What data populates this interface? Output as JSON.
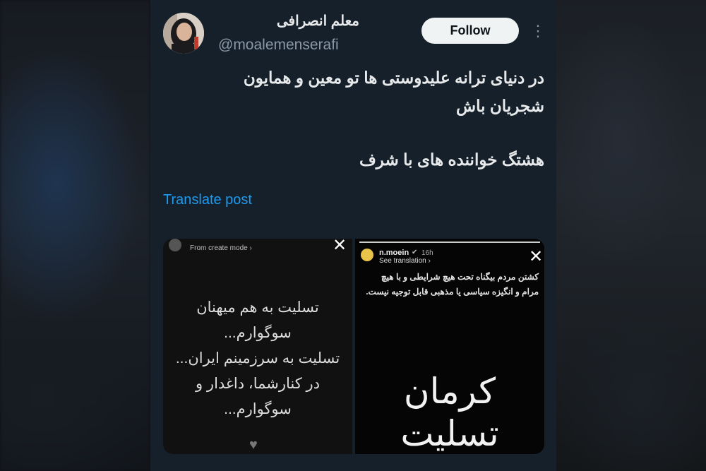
{
  "post": {
    "author_name": "معلم انصرافی",
    "handle": "@moalemenserafi",
    "follow_label": "Follow",
    "text_line1": "در دنیای ترانه علیدوستی ها تو معین و همایون",
    "text_line2": "شجریان باش",
    "text_line3": "هشتگ خواننده های با شرف",
    "translate_label": "Translate post"
  },
  "media": {
    "left_story": {
      "header_sub": "From create mode ›",
      "body_lines": [
        "تسلیت به هم میهنان",
        "سوگوارم...",
        "تسلیت به سرزمینم ایران...",
        "در کنارشما، داغدار و",
        "سوگوارم..."
      ]
    },
    "right_story": {
      "username": "n.moein",
      "time": "16h",
      "translation_label": "See translation ›",
      "small_text_line1": "کشتن مردم بیگناه تحت هیچ شرایطی و با هیچ",
      "small_text_line2": "مرام و انگیزه سیاسی یا مذهبی قابل توجیه نیست.",
      "big_text": "کرمان تسلیت"
    }
  },
  "colors": {
    "accent": "#1d9bf0",
    "background": "#15202b",
    "text": "#e7e9ea",
    "secondary_text": "#8b98a5"
  },
  "icons": [
    "more-vertical-icon",
    "close-icon",
    "verified-icon",
    "heart-icon"
  ]
}
